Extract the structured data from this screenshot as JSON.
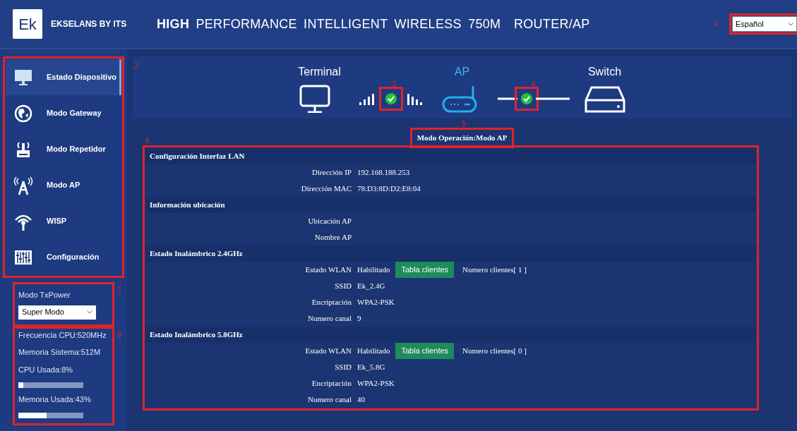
{
  "header": {
    "logo": "Ek",
    "brand": "EKSELANS BY ITS",
    "title": "**HIGH** PERFORMANCE INTELLIGENT WIRELESS 750M  ROUTER/AP",
    "language": {
      "value": "Español",
      "callout": "1"
    }
  },
  "sidebar": {
    "callout": "2",
    "items": [
      {
        "label": "Estado Dispositivo",
        "selected": true
      },
      {
        "label": "Modo Gateway",
        "selected": false
      },
      {
        "label": "Modo Repetidor",
        "selected": false
      },
      {
        "label": "Modo AP",
        "selected": false
      },
      {
        "label": "WISP",
        "selected": false
      },
      {
        "label": "Configuración",
        "selected": false
      }
    ]
  },
  "txpower": {
    "label": "Modo TxPower",
    "value": "Super Modo",
    "callout": "7"
  },
  "stats": {
    "callout": "8",
    "lines": [
      {
        "kind": "text",
        "text": "Frecuencia CPU:520MHz"
      },
      {
        "kind": "text",
        "text": "Memoria Sistema:512M"
      },
      {
        "kind": "meter",
        "text": "CPU Usada:8%",
        "level": 0.08
      },
      {
        "kind": "meter",
        "text": "Memoria Usada:43%",
        "level": 0.43
      }
    ]
  },
  "topology": {
    "nodes": [
      {
        "label": "Terminal",
        "active": false
      },
      {
        "label": "AP",
        "active": true
      },
      {
        "label": "Switch",
        "active": false
      }
    ],
    "links": [
      {
        "kind": "wireless",
        "connected": true,
        "callout": "3"
      },
      {
        "kind": "wired",
        "connected": true,
        "callout": "4"
      }
    ]
  },
  "mode": {
    "text": "Modo Operación:Modo AP",
    "callout": "5"
  },
  "info": {
    "callout": "6",
    "sections": [
      {
        "title": "Configuración Interfaz LAN",
        "rows": [
          {
            "label": "Dirección IP",
            "value": "192.168.188.253"
          },
          {
            "label": "Dirección MAC",
            "value": "78:D3:8D:D2:E8:04"
          }
        ]
      },
      {
        "title": "Información ubicación",
        "rows": [
          {
            "label": "Ubicación AP"
          },
          {
            "label": "Nombre AP"
          }
        ]
      },
      {
        "title": "Estado Inalámbrico 2.4GHz",
        "rows": [
          {
            "label": "Estado WLAN",
            "value": "Habilitado",
            "button": "Tabla clientes",
            "extra": "Numero clientes[ 1 ]"
          },
          {
            "label": "SSID",
            "value": "Ek_2.4G"
          },
          {
            "label": "Encriptación",
            "value": "WPA2-PSK"
          },
          {
            "label": "Numero canal",
            "value": "9"
          }
        ]
      },
      {
        "title": "Estado Inalámbrico 5.8GHz",
        "rows": [
          {
            "label": "Estado WLAN",
            "value": "Habilitado",
            "button": "Tabla clientes",
            "extra": "Numero clientes[ 0 ]"
          },
          {
            "label": "SSID",
            "value": "Ek_5.8G"
          },
          {
            "label": "Encriptación",
            "value": "WPA2-PSK"
          },
          {
            "label": "Numero canal",
            "value": "40"
          }
        ]
      }
    ]
  }
}
